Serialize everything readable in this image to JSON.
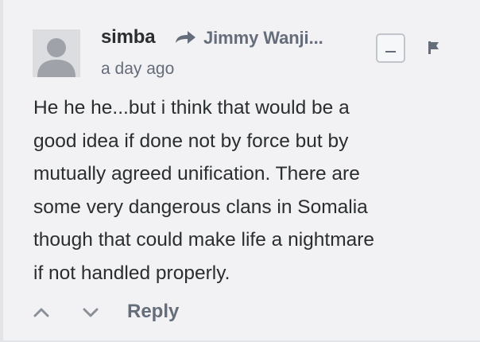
{
  "comment": {
    "author": "simba",
    "in_reply_to": "Jimmy Wanji...",
    "timestamp": "a day ago",
    "message_lines": [
      "He he he...but i think that would be a",
      "good idea if done not by force but by",
      "mutually agreed unification. There are",
      "some very dangerous clans in Somalia",
      "though that could make life a nightmare",
      "if not handled properly."
    ]
  },
  "actions": {
    "reply_label": "Reply"
  },
  "icons": {
    "avatar": "default-avatar-icon",
    "reply_arrow": "reply-arrow-icon",
    "collapse": "minus-icon",
    "flag": "flag-icon",
    "upvote": "chevron-up-icon",
    "downvote": "chevron-down-icon"
  },
  "colors": {
    "background": "#f2f2f4",
    "text": "#2a2e2e",
    "muted": "#656c7a",
    "avatar_bg": "#dcdde0",
    "avatar_fg": "#9fa2a8"
  }
}
